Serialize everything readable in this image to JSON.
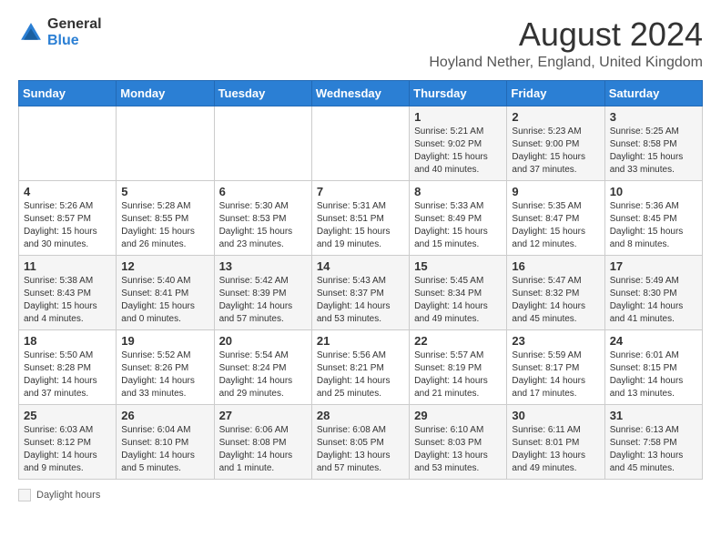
{
  "header": {
    "logo_general": "General",
    "logo_blue": "Blue",
    "title": "August 2024",
    "subtitle": "Hoyland Nether, England, United Kingdom"
  },
  "columns": [
    "Sunday",
    "Monday",
    "Tuesday",
    "Wednesday",
    "Thursday",
    "Friday",
    "Saturday"
  ],
  "weeks": [
    [
      {
        "day": "",
        "info": ""
      },
      {
        "day": "",
        "info": ""
      },
      {
        "day": "",
        "info": ""
      },
      {
        "day": "",
        "info": ""
      },
      {
        "day": "1",
        "info": "Sunrise: 5:21 AM\nSunset: 9:02 PM\nDaylight: 15 hours and 40 minutes."
      },
      {
        "day": "2",
        "info": "Sunrise: 5:23 AM\nSunset: 9:00 PM\nDaylight: 15 hours and 37 minutes."
      },
      {
        "day": "3",
        "info": "Sunrise: 5:25 AM\nSunset: 8:58 PM\nDaylight: 15 hours and 33 minutes."
      }
    ],
    [
      {
        "day": "4",
        "info": "Sunrise: 5:26 AM\nSunset: 8:57 PM\nDaylight: 15 hours and 30 minutes."
      },
      {
        "day": "5",
        "info": "Sunrise: 5:28 AM\nSunset: 8:55 PM\nDaylight: 15 hours and 26 minutes."
      },
      {
        "day": "6",
        "info": "Sunrise: 5:30 AM\nSunset: 8:53 PM\nDaylight: 15 hours and 23 minutes."
      },
      {
        "day": "7",
        "info": "Sunrise: 5:31 AM\nSunset: 8:51 PM\nDaylight: 15 hours and 19 minutes."
      },
      {
        "day": "8",
        "info": "Sunrise: 5:33 AM\nSunset: 8:49 PM\nDaylight: 15 hours and 15 minutes."
      },
      {
        "day": "9",
        "info": "Sunrise: 5:35 AM\nSunset: 8:47 PM\nDaylight: 15 hours and 12 minutes."
      },
      {
        "day": "10",
        "info": "Sunrise: 5:36 AM\nSunset: 8:45 PM\nDaylight: 15 hours and 8 minutes."
      }
    ],
    [
      {
        "day": "11",
        "info": "Sunrise: 5:38 AM\nSunset: 8:43 PM\nDaylight: 15 hours and 4 minutes."
      },
      {
        "day": "12",
        "info": "Sunrise: 5:40 AM\nSunset: 8:41 PM\nDaylight: 15 hours and 0 minutes."
      },
      {
        "day": "13",
        "info": "Sunrise: 5:42 AM\nSunset: 8:39 PM\nDaylight: 14 hours and 57 minutes."
      },
      {
        "day": "14",
        "info": "Sunrise: 5:43 AM\nSunset: 8:37 PM\nDaylight: 14 hours and 53 minutes."
      },
      {
        "day": "15",
        "info": "Sunrise: 5:45 AM\nSunset: 8:34 PM\nDaylight: 14 hours and 49 minutes."
      },
      {
        "day": "16",
        "info": "Sunrise: 5:47 AM\nSunset: 8:32 PM\nDaylight: 14 hours and 45 minutes."
      },
      {
        "day": "17",
        "info": "Sunrise: 5:49 AM\nSunset: 8:30 PM\nDaylight: 14 hours and 41 minutes."
      }
    ],
    [
      {
        "day": "18",
        "info": "Sunrise: 5:50 AM\nSunset: 8:28 PM\nDaylight: 14 hours and 37 minutes."
      },
      {
        "day": "19",
        "info": "Sunrise: 5:52 AM\nSunset: 8:26 PM\nDaylight: 14 hours and 33 minutes."
      },
      {
        "day": "20",
        "info": "Sunrise: 5:54 AM\nSunset: 8:24 PM\nDaylight: 14 hours and 29 minutes."
      },
      {
        "day": "21",
        "info": "Sunrise: 5:56 AM\nSunset: 8:21 PM\nDaylight: 14 hours and 25 minutes."
      },
      {
        "day": "22",
        "info": "Sunrise: 5:57 AM\nSunset: 8:19 PM\nDaylight: 14 hours and 21 minutes."
      },
      {
        "day": "23",
        "info": "Sunrise: 5:59 AM\nSunset: 8:17 PM\nDaylight: 14 hours and 17 minutes."
      },
      {
        "day": "24",
        "info": "Sunrise: 6:01 AM\nSunset: 8:15 PM\nDaylight: 14 hours and 13 minutes."
      }
    ],
    [
      {
        "day": "25",
        "info": "Sunrise: 6:03 AM\nSunset: 8:12 PM\nDaylight: 14 hours and 9 minutes."
      },
      {
        "day": "26",
        "info": "Sunrise: 6:04 AM\nSunset: 8:10 PM\nDaylight: 14 hours and 5 minutes."
      },
      {
        "day": "27",
        "info": "Sunrise: 6:06 AM\nSunset: 8:08 PM\nDaylight: 14 hours and 1 minute."
      },
      {
        "day": "28",
        "info": "Sunrise: 6:08 AM\nSunset: 8:05 PM\nDaylight: 13 hours and 57 minutes."
      },
      {
        "day": "29",
        "info": "Sunrise: 6:10 AM\nSunset: 8:03 PM\nDaylight: 13 hours and 53 minutes."
      },
      {
        "day": "30",
        "info": "Sunrise: 6:11 AM\nSunset: 8:01 PM\nDaylight: 13 hours and 49 minutes."
      },
      {
        "day": "31",
        "info": "Sunrise: 6:13 AM\nSunset: 7:58 PM\nDaylight: 13 hours and 45 minutes."
      }
    ]
  ],
  "footer": {
    "label": "Daylight hours"
  }
}
